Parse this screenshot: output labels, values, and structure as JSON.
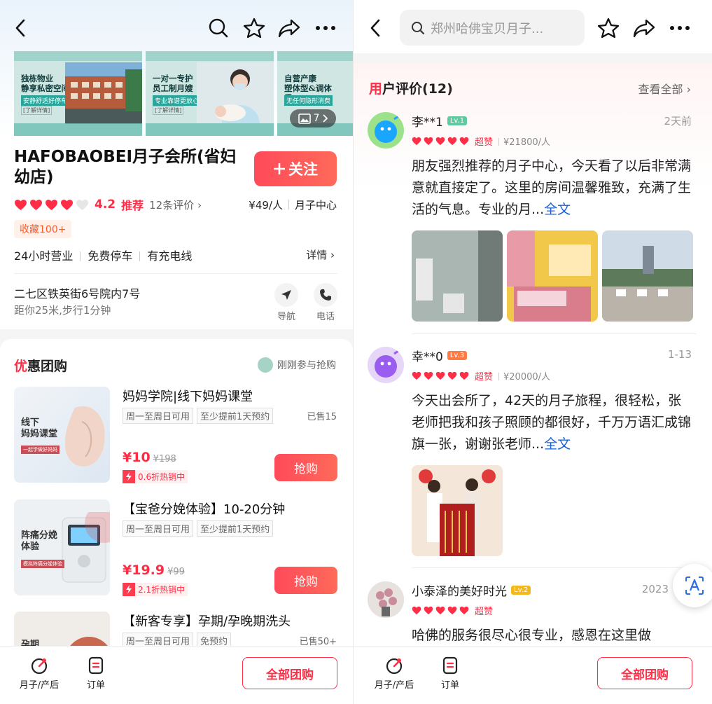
{
  "left": {
    "gallery": {
      "images": [
        {
          "title": "独栋物业\n静享私密空间",
          "tag": "安静舒适好停车",
          "tag2": "[了解详情]"
        },
        {
          "title": "一对一专护\n员工制月嫂",
          "tag": "专业靠谱更放心",
          "tag2": "[了解详情]"
        },
        {
          "title": "自营产康\n塑体型&调体质",
          "tag": "无任何隐形消费",
          "tag2": ""
        }
      ],
      "photo_count": "7"
    },
    "store": {
      "name": "HAFOBAOBEI月子会所(省妇幼店)",
      "follow_label": "关注",
      "rating_score": 4.2,
      "hearts_filled": 4,
      "score_text": "4.2",
      "recommend": "推荐",
      "reviews_link": "12条评价",
      "price": "¥49/人",
      "category": "月子中心",
      "favorites": "收藏100+",
      "amenities": [
        "24小时营业",
        "免费停车",
        "有充电线"
      ],
      "details": "详情",
      "address": "二七区铁英街6号院内7号",
      "distance": "距你25米,步行1分钟",
      "nav_label": "导航",
      "phone_label": "电话"
    },
    "deals_section": {
      "title_first": "优",
      "title_rest": "惠团购",
      "joined": "刚刚参与抢购",
      "items": [
        {
          "thumb": "线下\n妈妈课堂",
          "thumb_sub": "一起学做好妈妈",
          "title": "妈妈学院|线下妈妈课堂",
          "chips": [
            "周一至周日可用",
            "至少提前1天预约"
          ],
          "sold": "已售15",
          "price": "¥10",
          "original": "¥198",
          "hot": "0.6折热销中",
          "buy": "抢购"
        },
        {
          "thumb": "阵痛分娩\n体验",
          "thumb_sub": "模拟阵痛分娩体验",
          "title": "【宝爸分娩体验】10-20分钟",
          "chips": [
            "周一至周日可用",
            "至少提前1天预约"
          ],
          "sold": "",
          "price": "¥19.9",
          "original": "¥99",
          "hot": "2.1折热销中",
          "buy": "抢购"
        },
        {
          "thumb": "孕期",
          "thumb_sub": "",
          "title": "【新客专享】孕期/孕晚期洗头",
          "chips": [
            "周一至周日可用",
            "免预约"
          ],
          "sold": "已售50+",
          "price": "",
          "original": "",
          "hot": "",
          "buy": ""
        }
      ]
    },
    "bottom": {
      "tab1": "月子/产后",
      "tab2": "订单",
      "all_deals": "全部团购"
    }
  },
  "right": {
    "search_placeholder": "郑州哈佛宝贝月子...",
    "reviews_header": {
      "title_first": "用",
      "title_rest": "户评价(12)",
      "view_all": "查看全部"
    },
    "reviews": [
      {
        "user": "李**1",
        "level": "Lv.1",
        "level_color": "#5fc9a0",
        "time": "2天前",
        "super": "超赞",
        "per_person": "¥21800/人",
        "text": "朋友强烈推荐的月子中心，今天看了以后非常满意就直接定了。这里的房间温馨雅致，充满了生活的气息。专业的月...",
        "full": "全文"
      },
      {
        "user": "幸**0",
        "level": "Lv.3",
        "level_color": "#ff7a45",
        "time": "1-13",
        "super": "超赞",
        "per_person": "¥20000/人",
        "text": "今天出会所了，42天的月子旅程，很轻松，张老师把我和孩子照顾的都很好，千万万语汇成锦旗一张，谢谢张老师...",
        "full": "全文"
      },
      {
        "user": "小泰泽的美好时光",
        "level": "Lv.2",
        "level_color": "#f5b81c",
        "time": "2023",
        "super": "超赞",
        "per_person": "",
        "text": "哈佛的服务很尽心很专业，感恩在这里做",
        "full": ""
      }
    ],
    "bottom": {
      "tab1": "月子/产后",
      "tab2": "订单",
      "all_deals": "全部团购"
    }
  },
  "colors": {
    "accent": "#ff2d46",
    "link": "#1a62d6"
  }
}
